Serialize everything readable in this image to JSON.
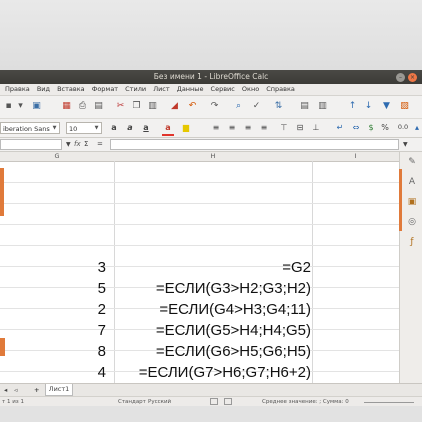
{
  "window": {
    "title": "Без имени 1 - LibreOffice Calc"
  },
  "menu": [
    "Правка",
    "Вид",
    "Вставка",
    "Формат",
    "Стили",
    "Лист",
    "Данные",
    "Сервис",
    "Окно",
    "Справка"
  ],
  "toolbar": {
    "font_name": "iberation Sans",
    "font_size": "10",
    "percent_label": "%",
    "decimal_label": "0.0"
  },
  "formula_bar": {
    "fx_label": "fx",
    "sigma_label": "Σ",
    "equals_label": "="
  },
  "columns": [
    {
      "letter": "G"
    },
    {
      "letter": "H"
    },
    {
      "letter": "I"
    }
  ],
  "cells": [
    {
      "g": "3",
      "h": "=G2"
    },
    {
      "g": "5",
      "h": "=ЕСЛИ(G3>H2;G3;H2)"
    },
    {
      "g": "2",
      "h": "=ЕСЛИ(G4>H3;G4;11)"
    },
    {
      "g": "7",
      "h": "=ЕСЛИ(G5>H4;H4;G5)"
    },
    {
      "g": "8",
      "h": "=ЕСЛИ(G6>H5;G6;H5)"
    },
    {
      "g": "4",
      "h": "=ЕСЛИ(G7>H6;G7;H6+2)"
    }
  ],
  "sheet_tabs": {
    "active": "Лист1"
  },
  "status": {
    "position": "т 1 из 1",
    "style": "Стандарт",
    "language": "Русский",
    "summary": "Среднее значение: ; Сумма: 0"
  },
  "colors": {
    "accent": "#e07a3a",
    "titlebar": "#3c3b37"
  }
}
